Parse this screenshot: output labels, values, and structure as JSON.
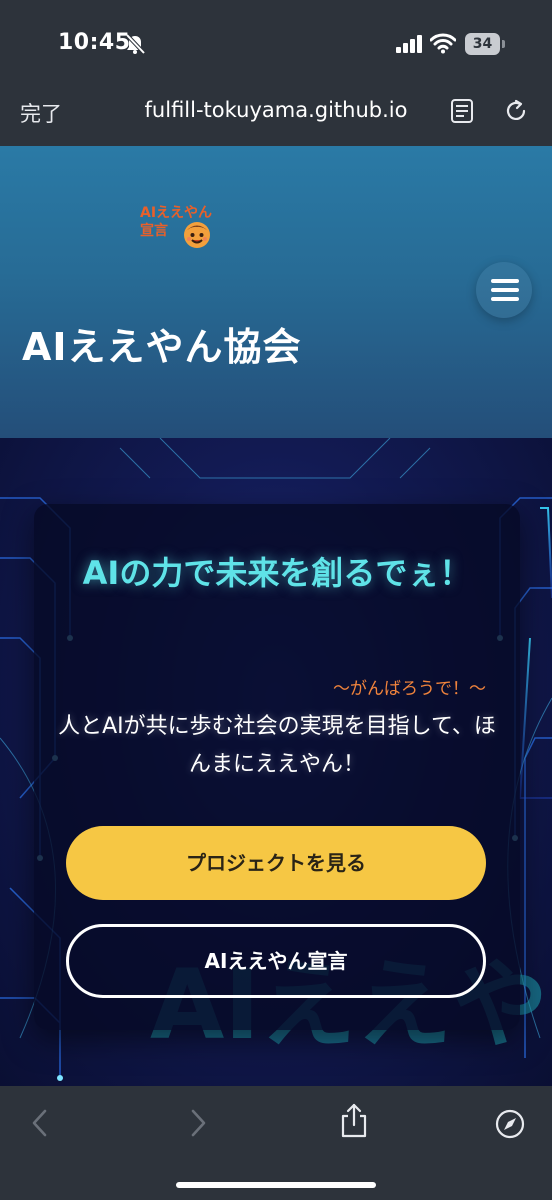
{
  "status_bar": {
    "time": "10:45",
    "battery": "34",
    "icons": [
      "bell-slash-icon",
      "signal-icon",
      "wifi-icon",
      "battery-icon"
    ]
  },
  "browser": {
    "done_label": "完了",
    "url": "fulfill-tokuyama.github.io",
    "icons": [
      "reader-icon",
      "reload-icon"
    ]
  },
  "header": {
    "logo_text": "AIええやん\n宣言",
    "title": "AIええやん協会",
    "menu_icon": "hamburger-menu-icon"
  },
  "hero": {
    "headline": "AIの力で未来を創るでぇ！",
    "tagline": "〜がんばろうで！〜",
    "description": "人とAIが共に歩む社会の実現を目指して、ほんまにええやん！",
    "primary_button": "プロジェクトを見る",
    "secondary_button": "AIええやん宣言",
    "background_text": "AIええやん"
  },
  "toolbar": {
    "icons": [
      "back-icon",
      "forward-icon",
      "share-icon",
      "compass-icon"
    ]
  },
  "colors": {
    "header_top": "#2a7aa6",
    "header_bottom": "#244e79",
    "headline": "#5fe3e8",
    "tagline": "#f0833c",
    "primary_button": "#f6c744",
    "chrome": "#2d333b"
  }
}
